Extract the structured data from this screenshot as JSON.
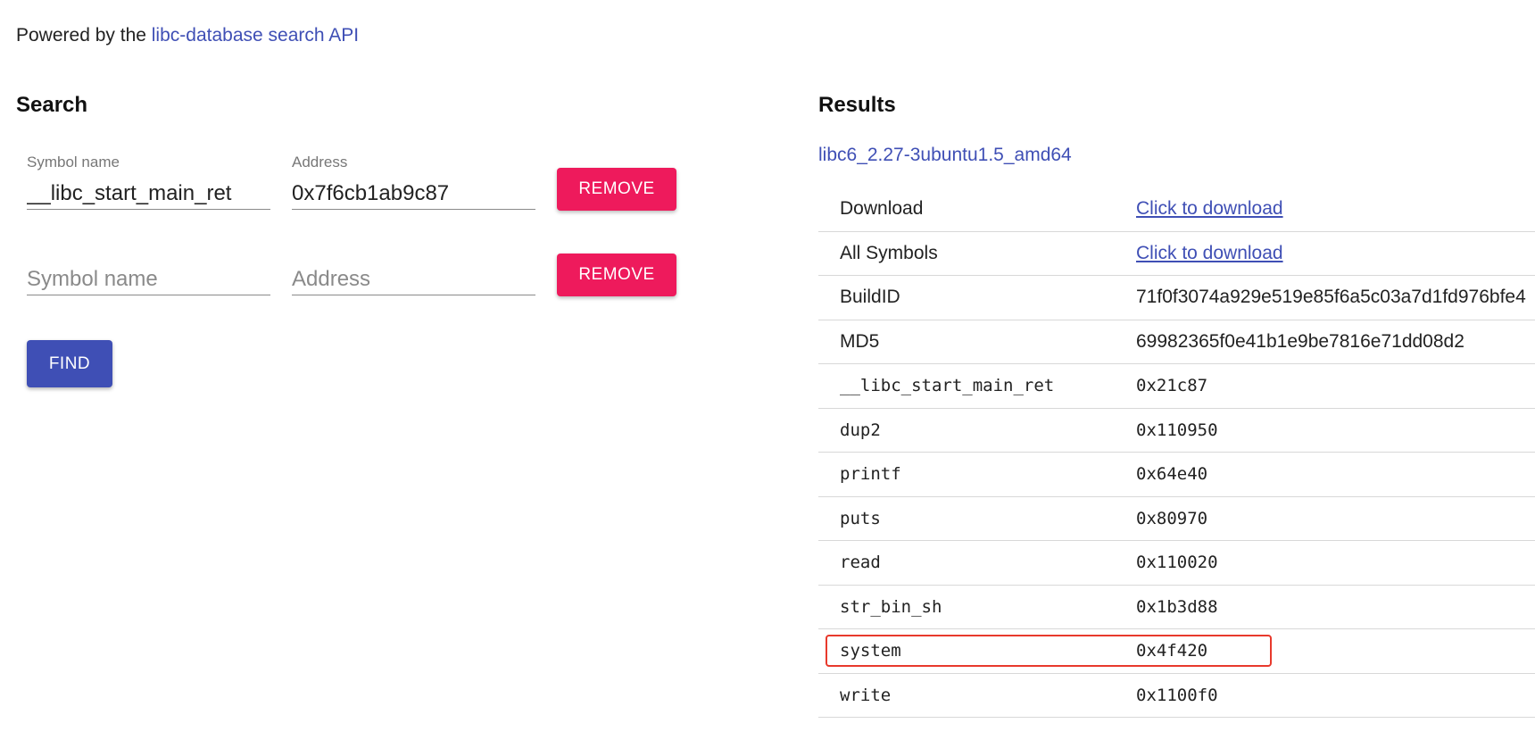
{
  "powered": {
    "prefix": "Powered by the ",
    "link_text": "libc-database search API"
  },
  "search": {
    "title": "Search",
    "rows": [
      {
        "symbol_label": "Symbol name",
        "symbol_value": "__libc_start_main_ret",
        "address_label": "Address",
        "address_value": "0x7f6cb1ab9c87",
        "remove_label": "REMOVE"
      },
      {
        "symbol_placeholder": "Symbol name",
        "address_placeholder": "Address",
        "remove_label": "REMOVE"
      }
    ],
    "find_label": "FIND"
  },
  "results": {
    "title": "Results",
    "libc_name": "libc6_2.27-3ubuntu1.5_amd64",
    "rows": [
      {
        "key": "Download",
        "value": "Click to download"
      },
      {
        "key": "All Symbols",
        "value": "Click to download"
      },
      {
        "key": "BuildID",
        "value": "71f0f3074a929e519e85f6a5c03a7d1fd976bfe4"
      },
      {
        "key": "MD5",
        "value": "69982365f0e41b1e9be7816e71dd08d2"
      },
      {
        "key": "__libc_start_main_ret",
        "value": "0x21c87"
      },
      {
        "key": "dup2",
        "value": "0x110950"
      },
      {
        "key": "printf",
        "value": "0x64e40"
      },
      {
        "key": "puts",
        "value": "0x80970"
      },
      {
        "key": "read",
        "value": "0x110020"
      },
      {
        "key": "str_bin_sh",
        "value": "0x1b3d88"
      },
      {
        "key": "system",
        "value": "0x4f420"
      },
      {
        "key": "write",
        "value": "0x1100f0"
      }
    ]
  },
  "colors": {
    "link": "#3f4fb5",
    "remove_button": "#ee1a5c",
    "find_button": "#3f4fb5",
    "highlight_box": "#e8392c"
  }
}
